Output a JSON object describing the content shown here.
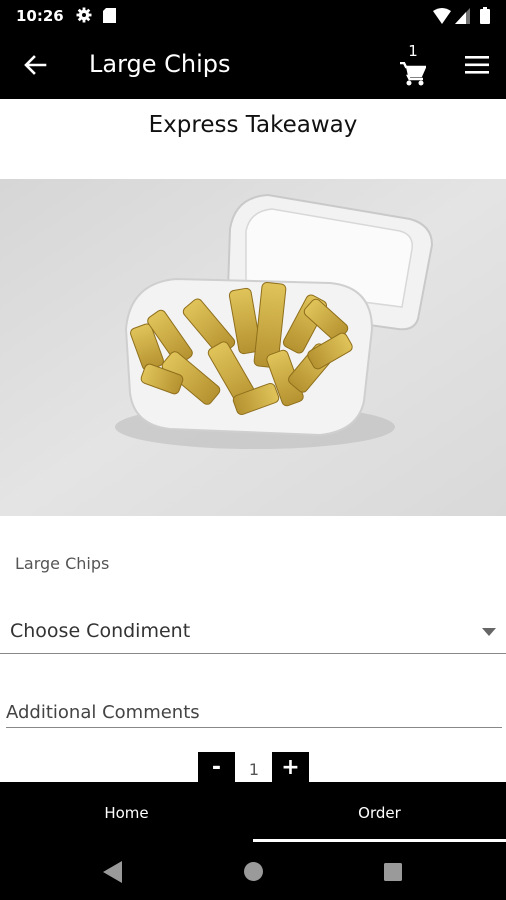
{
  "status_bar": {
    "time": "10:26",
    "icons": [
      "gear-icon",
      "sd-card-icon",
      "wifi-icon",
      "signal-icon",
      "battery-icon"
    ]
  },
  "app_bar": {
    "title": "Large Chips",
    "cart_count": "1",
    "icons": [
      "arrow-back-icon",
      "cart-icon",
      "menu-icon"
    ]
  },
  "restaurant": {
    "name": "Express Takeaway"
  },
  "product": {
    "label": "Large Chips"
  },
  "condiment": {
    "selected": "Choose Condiment"
  },
  "comments": {
    "placeholder": "Additional Comments"
  },
  "quantity": {
    "minus_label": "-",
    "value": "1",
    "plus_label": "+"
  },
  "bottom_nav": {
    "home": "Home",
    "order": "Order",
    "active": "Order"
  },
  "colors": {
    "bar_background": "#000000",
    "text_on_bar": "#ffffff"
  }
}
